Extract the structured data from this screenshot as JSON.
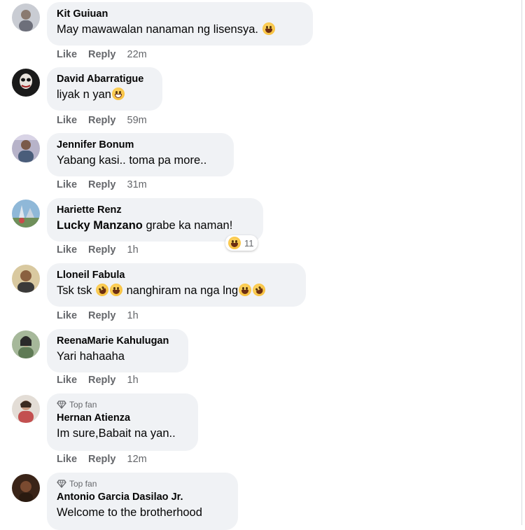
{
  "actions": {
    "like": "Like",
    "reply": "Reply"
  },
  "comments": [
    {
      "author": "Kit Guiuan",
      "text": "May mawawalan nanaman ng lisensya. ",
      "emoji": [
        "laugh-emoji"
      ],
      "time": "22m"
    },
    {
      "author": "David Abarratigue",
      "text": "liyak n yan",
      "emoji": [
        "grin-emoji"
      ],
      "time": "59m"
    },
    {
      "author": "Jennifer Bonum",
      "text": "Yabang kasi.. toma pa more..",
      "time": "31m"
    },
    {
      "author": "Hariette Renz",
      "mention": "Lucky Manzano",
      "text": " grabe ka naman!",
      "time": "1h",
      "reaction": {
        "emoji": "laugh-emoji",
        "count": "11"
      }
    },
    {
      "author": "Lloneil Fabula",
      "text_parts": [
        "Tsk tsk ",
        " nanghiram na nga lng",
        ""
      ],
      "time": "1h"
    },
    {
      "author": "ReenaMarie Kahulugan",
      "text": "Yari hahaaha",
      "time": "1h"
    },
    {
      "author": "Hernan Atienza",
      "badge": "Top fan",
      "text": "Im sure,Babait na yan..",
      "time": "12m"
    },
    {
      "author": "Antonio Garcia Dasilao Jr.",
      "badge": "Top fan",
      "text": "Welcome to the brotherhood"
    }
  ],
  "colors": {
    "bubble": "#f0f2f5",
    "meta": "#65676b",
    "text": "#050505"
  }
}
